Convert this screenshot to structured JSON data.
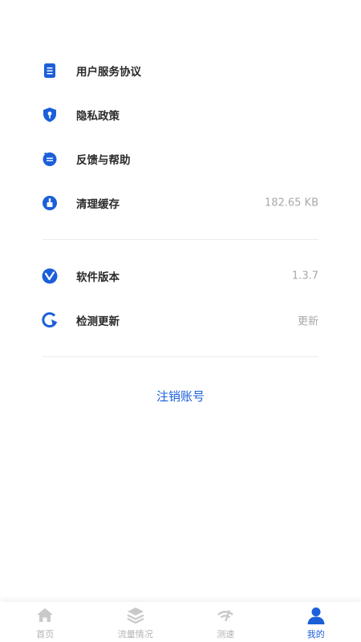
{
  "menu": {
    "items": [
      {
        "label": "用户服务协议",
        "value": "",
        "icon": "document-icon"
      },
      {
        "label": "隐私政策",
        "value": "",
        "icon": "shield-icon"
      },
      {
        "label": "反馈与帮助",
        "value": "",
        "icon": "feedback-icon"
      },
      {
        "label": "清理缓存",
        "value": "182.65 KB",
        "icon": "broom-icon"
      }
    ],
    "items2": [
      {
        "label": "软件版本",
        "value": "1.3.7",
        "icon": "version-icon"
      },
      {
        "label": "检测更新",
        "value": "更新",
        "icon": "refresh-icon"
      }
    ]
  },
  "logout_label": "注销账号",
  "tabbar": {
    "tabs": [
      {
        "label": "首页",
        "icon": "home-icon"
      },
      {
        "label": "流量情况",
        "icon": "layers-icon"
      },
      {
        "label": "测速",
        "icon": "speed-icon"
      },
      {
        "label": "我的",
        "icon": "user-icon",
        "active": true
      }
    ]
  },
  "colors": {
    "accent": "#1b5fd9",
    "muted": "#b3b3b3",
    "value": "#a9a9a9"
  }
}
